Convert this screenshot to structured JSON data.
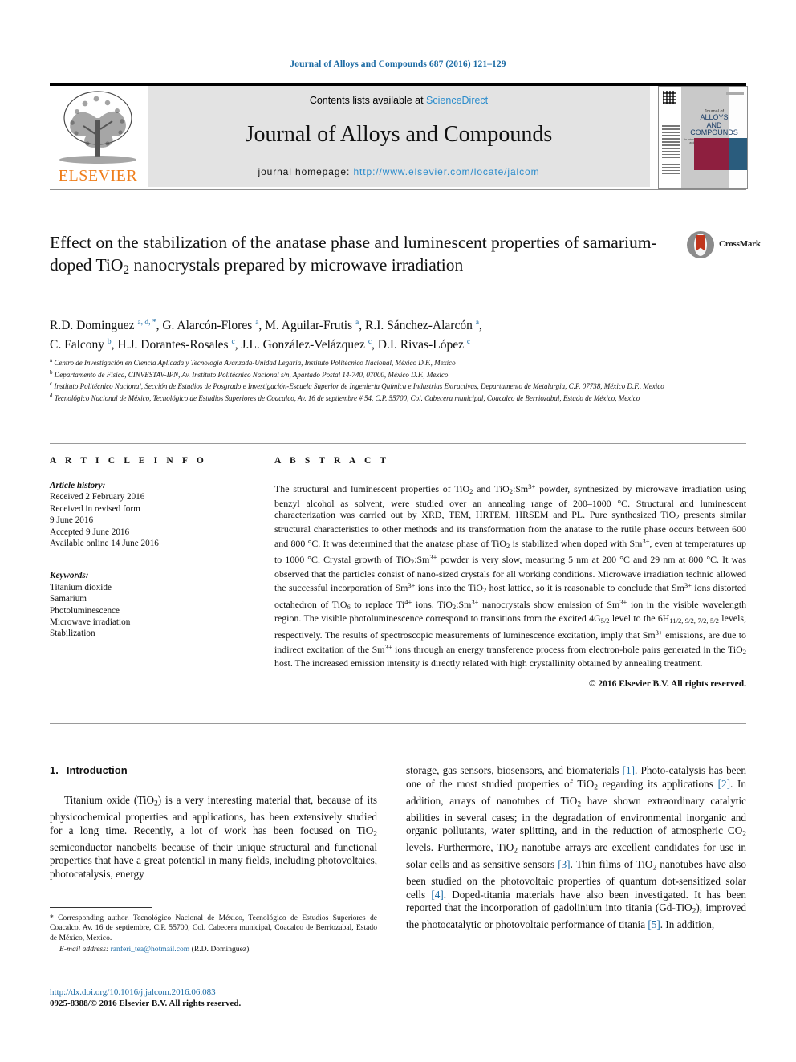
{
  "running_head": "Journal of Alloys and Compounds 687 (2016) 121–129",
  "masthead": {
    "contents_prefix": "Contents lists available at ",
    "sciencedirect": "ScienceDirect",
    "journal_title": "Journal of Alloys and Compounds",
    "homepage_prefix": "journal homepage: ",
    "homepage_url": "http://www.elsevier.com/locate/jalcom",
    "publisher": "ELSEVIER",
    "cover": {
      "line1": "Journal of",
      "line2": "ALLOYS",
      "line3": "AND COMPOUNDS",
      "line4": "An Interdisciplinary Journal of Materials Science and Solid-state Chemistry and Physics"
    },
    "colors": {
      "link": "#2b8ccc",
      "band": "#e3e3e3",
      "elsevier_orange": "#ef7d1a",
      "cover_maroon": "#8e1f3f",
      "cover_blue": "#2a5c7d"
    }
  },
  "crossmark": {
    "label": "CrossMark"
  },
  "title_html": "Effect on the stabilization of the anatase phase and luminescent properties of samarium-doped TiO<sub>2</sub> nanocrystals prepared by microwave irradiation",
  "authors_html": "R.D. Dominguez <sup>a, d, *</sup>, G. Alarcón-Flores <sup>a</sup>, M. Aguilar-Frutis <sup>a</sup>, R.I. Sánchez-Alarcón <sup>a</sup>,<br>C. Falcony <sup>b</sup>, H.J. Dorantes-Rosales <sup>c</sup>, J.L. González-Velázquez <sup>c</sup>, D.I. Rivas-López <sup>c</sup>",
  "affiliations": [
    {
      "marker": "a",
      "text": "Centro de Investigación en Ciencia Aplicada y Tecnología Avanzada-Unidad Legaria, Instituto Politécnico Nacional, México D.F., Mexico"
    },
    {
      "marker": "b",
      "text": "Departamento de Física, CINVESTAV-IPN, Av. Instituto Politécnico Nacional s/n, Apartado Postal 14-740, 07000, México D.F., Mexico"
    },
    {
      "marker": "c",
      "text": "Instituto Politécnico Nacional, Sección de Estudios de Posgrado e Investigación-Escuela Superior de Ingeniería Química e Industrias Extractivas, Departamento de Metalurgia, C.P. 07738, México D.F., Mexico"
    },
    {
      "marker": "d",
      "text": "Tecnológico Nacional de México, Tecnológico de Estudios Superiores de Coacalco, Av. 16 de septiembre # 54, C.P. 55700, Col. Cabecera municipal, Coacalco de Berriozabal, Estado de México, Mexico"
    }
  ],
  "article_info": {
    "heading": "A R T I C L E  I N F O",
    "history_label": "Article history:",
    "history": [
      "Received 2 February 2016",
      "Received in revised form",
      "9 June 2016",
      "Accepted 9 June 2016",
      "Available online 14 June 2016"
    ],
    "keywords_label": "Keywords:",
    "keywords": [
      "Titanium dioxide",
      "Samarium",
      "Photoluminescence",
      "Microwave irradiation",
      "Stabilization"
    ]
  },
  "abstract": {
    "heading": "A B S T R A C T",
    "body_html": "The structural and luminescent properties of TiO<sub>2</sub> and TiO<sub>2</sub>:Sm<sup>3+</sup> powder, synthesized by microwave irradiation using benzyl alcohol as solvent, were studied over an annealing range of 200–1000 °C. Structural and luminescent characterization was carried out by XRD, TEM, HRTEM, HRSEM and PL. Pure synthesized TiO<sub>2</sub> presents similar structural characteristics to other methods and its transformation from the anatase to the rutile phase occurs between 600 and 800 °C. It was determined that the anatase phase of TiO<sub>2</sub> is stabilized when doped with Sm<sup>3+</sup>, even at temperatures up to 1000 °C. Crystal growth of TiO<sub>2</sub>:Sm<sup>3+</sup> powder is very slow, measuring 5 nm at 200 °C and 29 nm at 800 °C. It was observed that the particles consist of nano-sized crystals for all working conditions. Microwave irradiation technic allowed the successful incorporation of Sm<sup>3+</sup> ions into the TiO<sub>2</sub> host lattice, so it is reasonable to conclude that Sm<sup>3+</sup> ions distorted octahedron of TiO<sub>6</sub> to replace Ti<sup>4+</sup> ions. TiO<sub>2</sub>:Sm<sup>3+</sup> nanocrystals show emission of Sm<sup>3+</sup> ion in the visible wavelength region. The visible photoluminescence correspond to transitions from the excited 4G<sub>5/2</sub> level to the 6H<sub>11/2, 9/2, 7/2, 5/2</sub> levels, respectively. The results of spectroscopic measurements of luminescence excitation, imply that Sm<sup>3+</sup> emissions, are due to indirect excitation of the Sm<sup>3+</sup> ions through an energy transference process from electron-hole pairs generated in the TiO<sub>2</sub> host. The increased emission intensity is directly related with high crystallinity obtained by annealing treatment.",
    "copyright": "© 2016 Elsevier B.V. All rights reserved."
  },
  "body": {
    "section_number": "1.",
    "section_title": "Introduction",
    "left_paragraph_html": "Titanium oxide (TiO<sub>2</sub>) is a very interesting material that, because of its physicochemical properties and applications, has been extensively studied for a long time. Recently, a lot of work has been focused on TiO<sub>2</sub> semiconductor nanobelts because of their unique structural and functional properties that have a great potential in many fields, including photovoltaics, photocatalysis, energy",
    "right_paragraph_html": "storage, gas sensors, biosensors, and biomaterials <span class=\"ref\">[1]</span>. Photo-catalysis has been one of the most studied properties of TiO<sub>2</sub> regarding its applications <span class=\"ref\">[2]</span>. In addition, arrays of nanotubes of TiO<sub>2</sub> have shown extraordinary catalytic abilities in several cases; in the degradation of environmental inorganic and organic pollutants, water splitting, and in the reduction of atmospheric CO<sub>2</sub> levels. Furthermore, TiO<sub>2</sub> nanotube arrays are excellent candidates for use in solar cells and as sensitive sensors <span class=\"ref\">[3]</span>. Thin films of TiO<sub>2</sub> nanotubes have also been studied on the photovoltaic properties of quantum dot-sensitized solar cells <span class=\"ref\">[4]</span>. Doped-titania materials have also been investigated. It has been reported that the incorporation of gadolinium into titania (Gd-TiO<sub>2</sub>), improved the photocatalytic or photovoltaic performance of titania <span class=\"ref\">[5]</span>. In addition,"
  },
  "footnote": {
    "text": "* Corresponding author. Tecnológico Nacional de México, Tecnológico de Estudios Superiores de Coacalco, Av. 16 de septiembre, C.P. 55700, Col. Cabecera municipal, Coacalco de Berriozabal, Estado de México, Mexico.",
    "email_label": "E-mail address:",
    "email": "ranferi_tea@hotmail.com",
    "email_owner": "(R.D. Dominguez)."
  },
  "doi": {
    "url": "http://dx.doi.org/10.1016/j.jalcom.2016.06.083",
    "issn_line": "0925-8388/© 2016 Elsevier B.V. All rights reserved."
  }
}
